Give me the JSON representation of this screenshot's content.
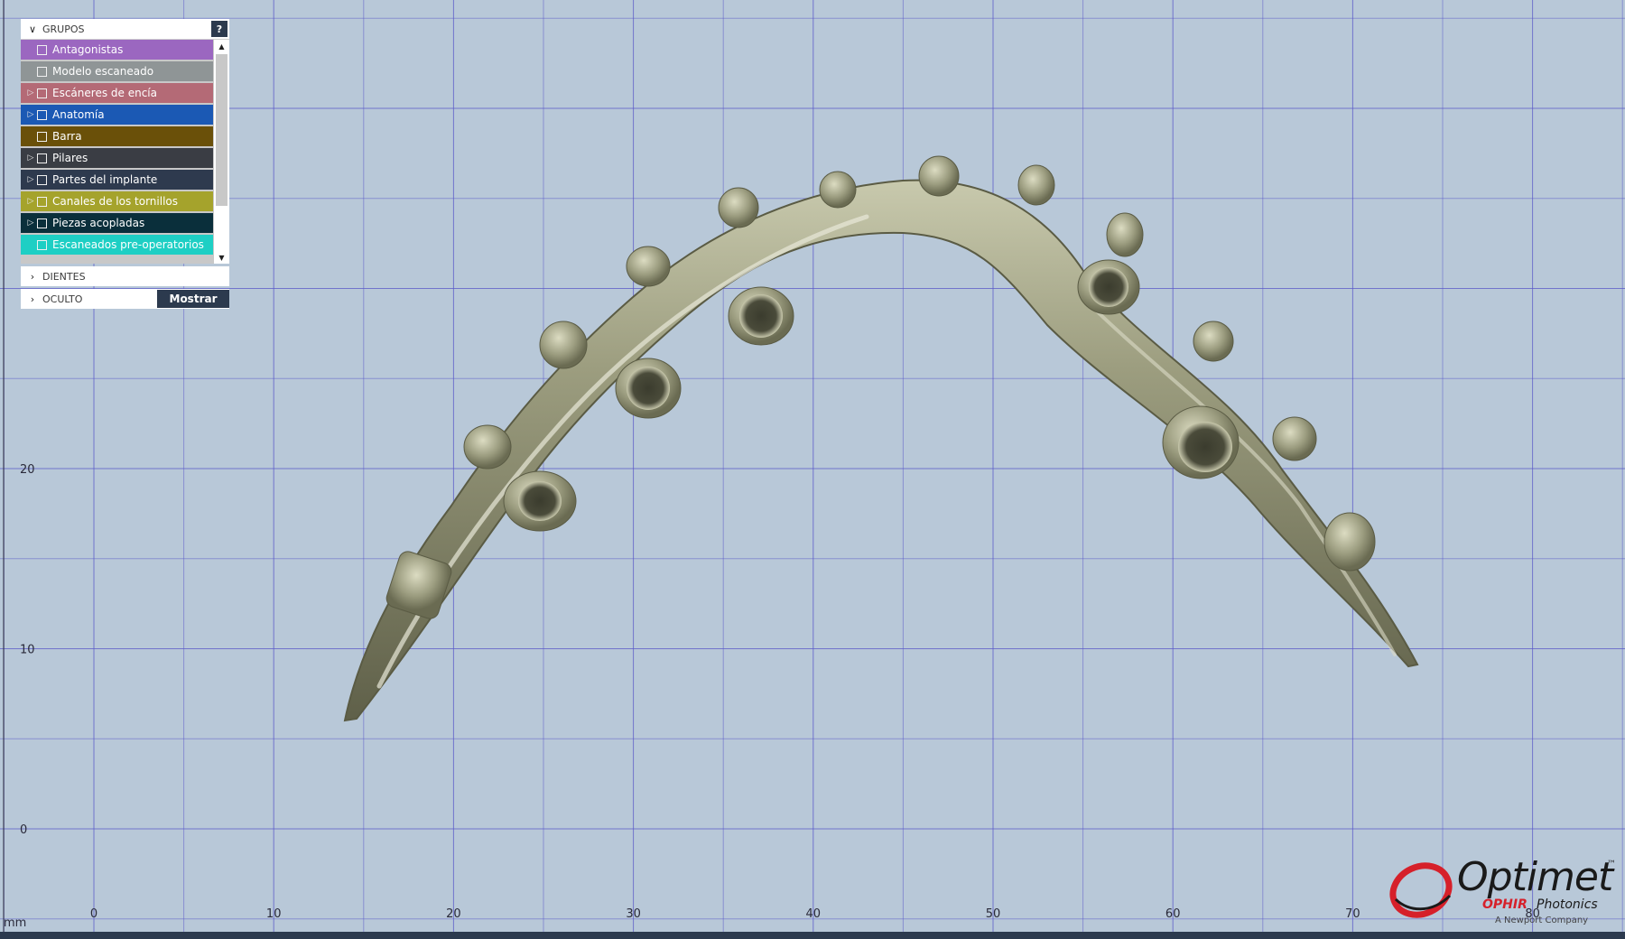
{
  "panel": {
    "header_label": "GRUPOS",
    "help_label": "?",
    "groups": [
      {
        "label": "Antagonistas",
        "color": "#9b67c0",
        "expandable": false
      },
      {
        "label": "Modelo escaneado",
        "color": "#8f9596",
        "expandable": false
      },
      {
        "label": "Escáneres de encía",
        "color": "#b46a76",
        "expandable": true
      },
      {
        "label": "Anatomía",
        "color": "#1b59b4",
        "expandable": true
      },
      {
        "label": "Barra",
        "color": "#6a5009",
        "expandable": false
      },
      {
        "label": "Pilares",
        "color": "#3a3d44",
        "expandable": true
      },
      {
        "label": "Partes del implante",
        "color": "#2e3a4e",
        "expandable": true
      },
      {
        "label": "Canales de los tornillos",
        "color": "#a5a32c",
        "expandable": true
      },
      {
        "label": "Piezas acopladas",
        "color": "#0a2f3b",
        "expandable": true
      },
      {
        "label": "Escaneados pre-operatorios",
        "color": "#1ecfc4",
        "expandable": false
      }
    ],
    "sections": [
      {
        "label": "DIENTES"
      },
      {
        "label": "OCULTO",
        "button_label": "Mostrar"
      }
    ]
  },
  "viewport": {
    "background": "#b8c8d8",
    "grid_color": "#5a58c8",
    "x_ticks": [
      "0",
      "10",
      "20",
      "30",
      "40",
      "50",
      "60",
      "70",
      "80"
    ],
    "y_ticks": [
      "20",
      "10",
      "0"
    ],
    "corner_label": "mm",
    "model_color": "#8a8c6e"
  },
  "logo": {
    "name": "Optimet",
    "tm": "™",
    "brand": "OPHIR",
    "sub": "Photonics",
    "tagline": "A Newport Company"
  }
}
